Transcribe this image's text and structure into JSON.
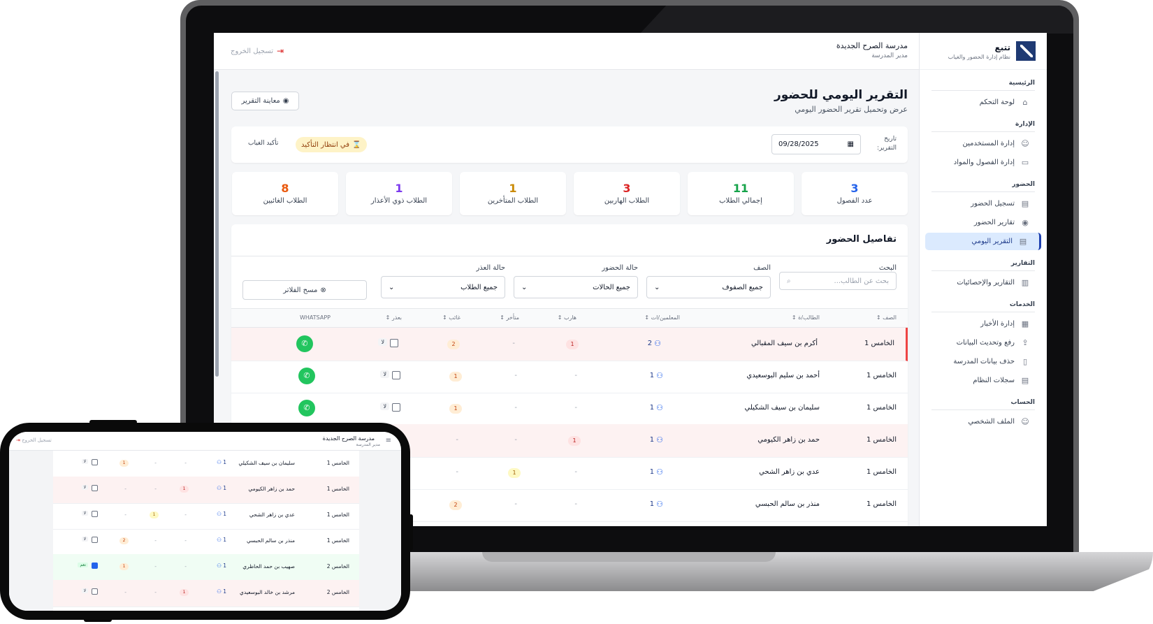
{
  "brand": {
    "name": "تتبع",
    "tagline": "نظام إدارة الحضور والغياب"
  },
  "sidebar": {
    "sections": [
      {
        "title": "الرئيسية",
        "items": [
          {
            "label": "لوحة التحكم",
            "icon": "home-icon"
          }
        ]
      },
      {
        "title": "الإدارة",
        "items": [
          {
            "label": "إدارة المستخدمين",
            "icon": "user-icon"
          },
          {
            "label": "إدارة الفصول والمواد",
            "icon": "book-icon"
          }
        ]
      },
      {
        "title": "الحضور",
        "items": [
          {
            "label": "تسجيل الحضور",
            "icon": "clipboard-icon"
          },
          {
            "label": "تقارير الحضور",
            "icon": "eye-icon"
          },
          {
            "label": "التقرير اليومي",
            "icon": "document-icon",
            "active": true
          }
        ]
      },
      {
        "title": "التقارير",
        "items": [
          {
            "label": "التقارير والإحصائيات",
            "icon": "bar-chart-icon"
          }
        ]
      },
      {
        "title": "الخدمات",
        "items": [
          {
            "label": "إدارة الأخبار",
            "icon": "newspaper-icon"
          },
          {
            "label": "رفع وتحديث البيانات",
            "icon": "upload-icon"
          },
          {
            "label": "حذف بيانات المدرسة",
            "icon": "trash-icon"
          },
          {
            "label": "سجلات النظام",
            "icon": "log-icon"
          }
        ]
      },
      {
        "title": "الحساب",
        "items": [
          {
            "label": "الملف الشخصي",
            "icon": "profile-icon"
          }
        ]
      }
    ]
  },
  "header": {
    "school_name": "مدرسة الصرح الجديدة",
    "role": "مدير المدرسة",
    "logout": "تسجيل الخروج"
  },
  "page": {
    "title": "التقرير اليومي للحضور",
    "subtitle": "عرض وتحميل تقرير الحضور اليومي",
    "preview_button": "معاينة التقرير"
  },
  "date_bar": {
    "label": "تاريخ التقرير:",
    "value": "09/28/2025",
    "status": "في انتظار التأكيد",
    "confirm": "تأكيد الغياب"
  },
  "stats": [
    {
      "value": "3",
      "label": "عدد الفصول",
      "color": "#2563eb"
    },
    {
      "value": "11",
      "label": "إجمالي الطلاب",
      "color": "#16a34a"
    },
    {
      "value": "3",
      "label": "الطلاب الهاربين",
      "color": "#dc2626"
    },
    {
      "value": "1",
      "label": "الطلاب المتأخرين",
      "color": "#ca8a04"
    },
    {
      "value": "1",
      "label": "الطلاب ذوي الأعذار",
      "color": "#7c3aed"
    },
    {
      "value": "8",
      "label": "الطلاب الغائبين",
      "color": "#ea580c"
    }
  ],
  "details": {
    "title": "تفاصيل الحضور",
    "filters": {
      "search_label": "البحث",
      "search_placeholder": "بحث عن الطالب...",
      "class_label": "الصف",
      "class_value": "جميع الصفوف",
      "status_label": "حالة الحضور",
      "status_value": "جميع الحالات",
      "excuse_label": "حالة العذر",
      "excuse_value": "جميع الطلاب",
      "clear": "مسح الفلاتر"
    },
    "columns": [
      "الصف",
      "الطالب/ة",
      "المعلمين/ات",
      "هارب",
      "متأخر",
      "غائب",
      "بعذر",
      "WHATSAPP"
    ],
    "rows": [
      {
        "class": "الخامس 1",
        "student": "أكرم بن سيف المقبالي",
        "teachers": "2",
        "escaped": "1",
        "late": "-",
        "absent": "2",
        "excuse": "لا",
        "highlight": true,
        "flag": true
      },
      {
        "class": "الخامس 1",
        "student": "أحمد بن سليم البوسعيدي",
        "teachers": "1",
        "escaped": "-",
        "late": "-",
        "absent": "1",
        "excuse": "لا",
        "highlight": false
      },
      {
        "class": "الخامس 1",
        "student": "سليمان بن سيف الشكيلي",
        "teachers": "1",
        "escaped": "-",
        "late": "-",
        "absent": "1",
        "excuse": "لا",
        "highlight": false
      },
      {
        "class": "الخامس 1",
        "student": "حمد بن زاهر الكيومي",
        "teachers": "1",
        "escaped": "1",
        "late": "-",
        "absent": "-",
        "excuse": "لا",
        "highlight": true
      },
      {
        "class": "الخامس 1",
        "student": "عدي بن زاهر الشحي",
        "teachers": "1",
        "escaped": "-",
        "late": "1",
        "absent": "-",
        "excuse": "لا",
        "highlight": false
      },
      {
        "class": "الخامس 1",
        "student": "منذر بن سالم الحبسي",
        "teachers": "1",
        "escaped": "-",
        "late": "-",
        "absent": "2",
        "excuse": "لا",
        "highlight": false
      }
    ]
  },
  "phone": {
    "rows": [
      {
        "class": "الخامس 1",
        "student": "سليمان بن سيف الشكيلي",
        "teachers": "1",
        "escaped": "-",
        "late": "-",
        "absent": "1",
        "excuse": "لا",
        "state": "normal",
        "checked": false
      },
      {
        "class": "الخامس 1",
        "student": "حمد بن زاهر الكيومي",
        "teachers": "1",
        "escaped": "1",
        "late": "-",
        "absent": "-",
        "excuse": "لا",
        "state": "absent",
        "checked": false
      },
      {
        "class": "الخامس 1",
        "student": "عدي بن زاهر الشحي",
        "teachers": "1",
        "escaped": "-",
        "late": "1",
        "absent": "-",
        "excuse": "لا",
        "state": "normal",
        "checked": false
      },
      {
        "class": "الخامس 1",
        "student": "منذر بن سالم الحبسي",
        "teachers": "1",
        "escaped": "-",
        "late": "-",
        "absent": "2",
        "excuse": "لا",
        "state": "normal",
        "checked": false
      },
      {
        "class": "الخامس 2",
        "student": "صهيب بن حمد الحاظري",
        "teachers": "1",
        "escaped": "-",
        "late": "-",
        "absent": "1",
        "excuse": "نعم",
        "state": "excused",
        "checked": true
      },
      {
        "class": "الخامس 2",
        "student": "مرشد بن خالد البوسعيدي",
        "teachers": "1",
        "escaped": "1",
        "late": "-",
        "absent": "-",
        "excuse": "لا",
        "state": "absent",
        "checked": false
      }
    ]
  }
}
